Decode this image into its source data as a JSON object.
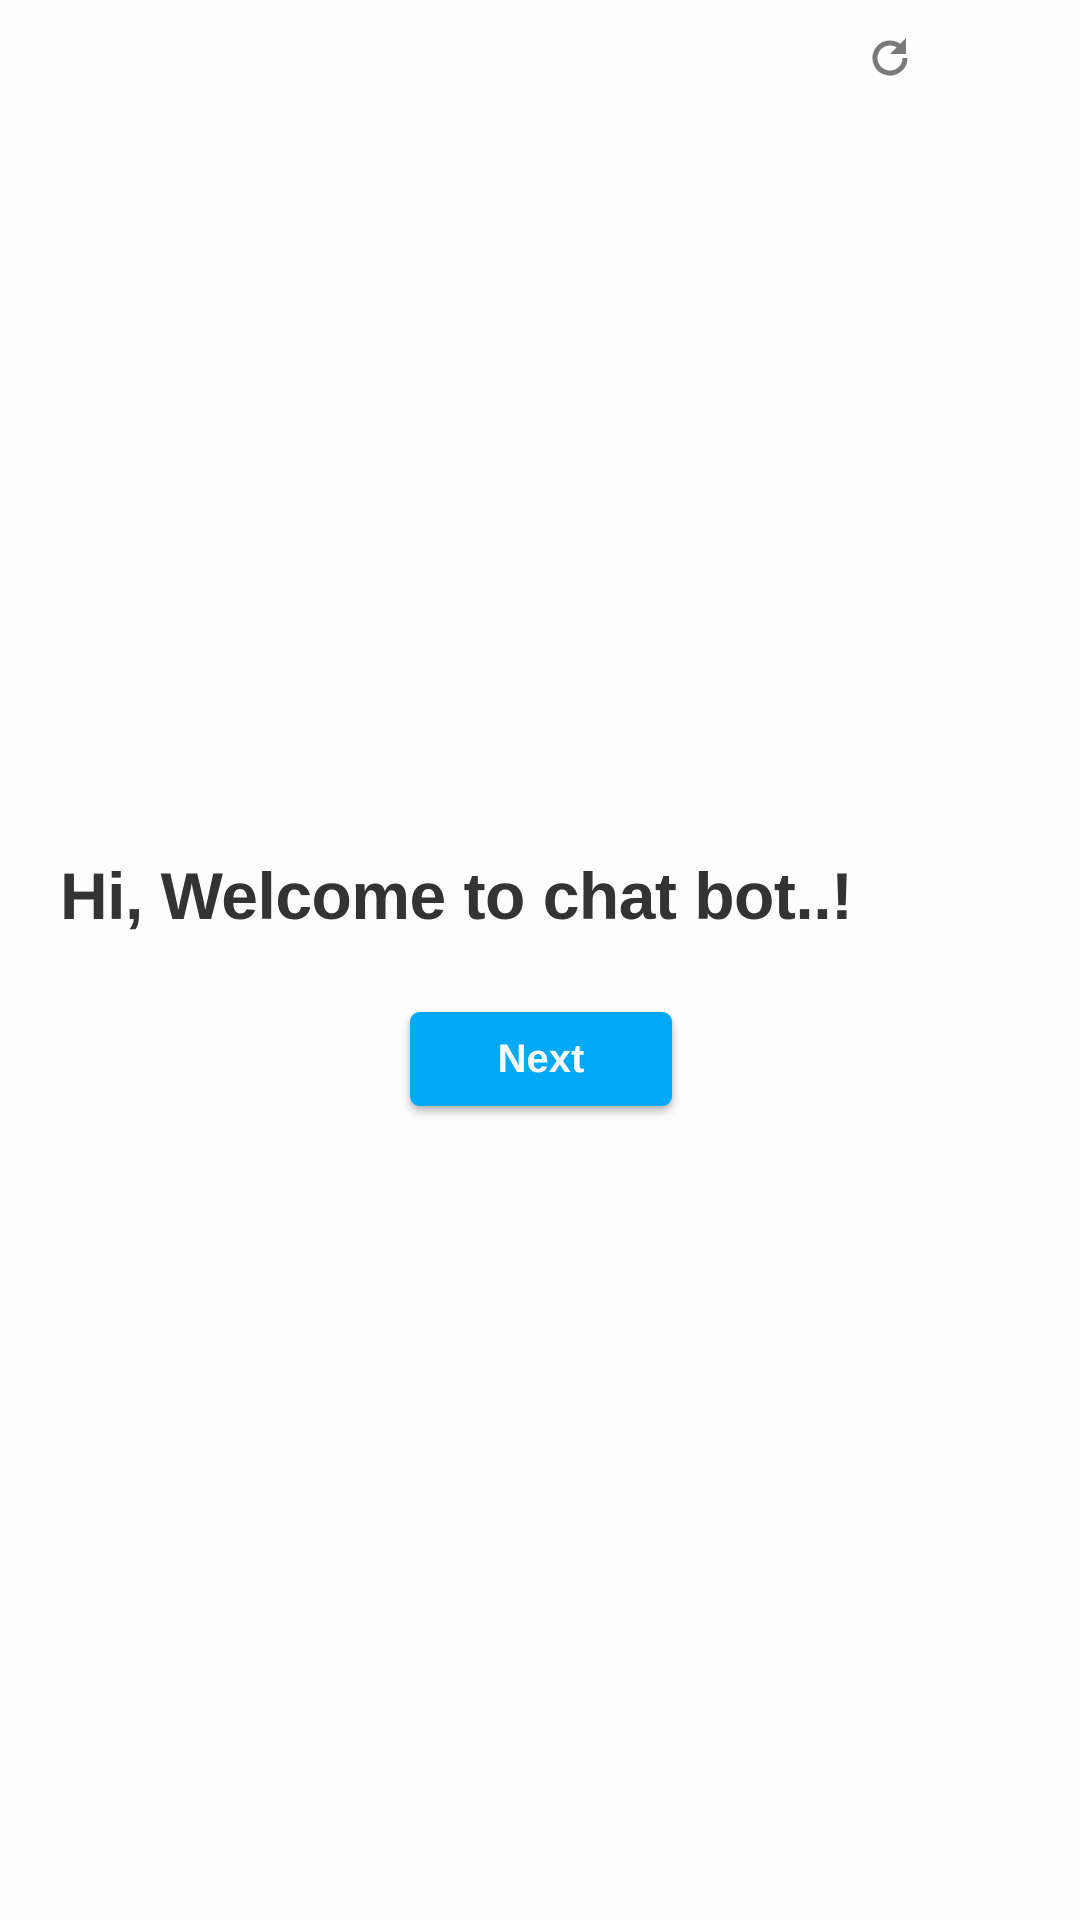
{
  "header": {
    "refresh_icon": "refresh-icon"
  },
  "main": {
    "title": "Hi, Welcome to chat bot..!",
    "next_label": "Next"
  },
  "colors": {
    "background": "#fdfdfd",
    "title_text": "#333333",
    "button_background": "#03a9f4",
    "button_text": "#ffffff",
    "icon": "#7a7a7a"
  }
}
